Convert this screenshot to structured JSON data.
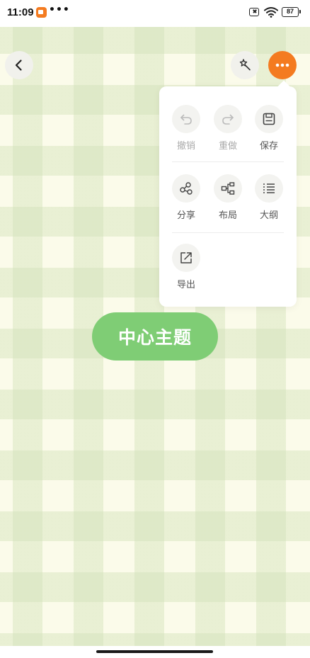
{
  "status_bar": {
    "time": "11:09",
    "more_indicator": "•••",
    "battery_level": "87"
  },
  "toolbar": {
    "back_icon": "chevron-left-icon",
    "magic_icon": "magic-wand-icon",
    "more_icon": "more-dots-icon",
    "more_color": "#f47b20"
  },
  "menu": {
    "undo_label": "撤销",
    "redo_label": "重做",
    "save_label": "保存",
    "share_label": "分享",
    "layout_label": "布局",
    "outline_label": "大纲",
    "export_label": "导出"
  },
  "canvas": {
    "center_topic": "中心主题",
    "topic_color": "#7fcd75"
  }
}
